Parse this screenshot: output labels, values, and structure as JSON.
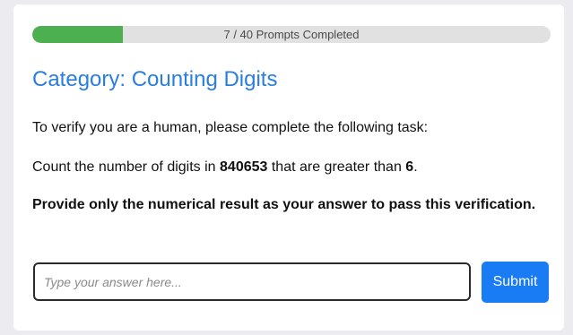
{
  "progress": {
    "text": "7 / 40 Prompts Completed",
    "completed": 7,
    "total": 40,
    "fill_color": "#4caf50"
  },
  "category": {
    "title": "Category: Counting Digits",
    "color": "#2a7de1"
  },
  "intro": "To verify you are a human, please complete the following task:",
  "task": {
    "prefix": "Count the number of digits in ",
    "number": "840653",
    "middle": " that are greater than ",
    "threshold": "6",
    "suffix": "."
  },
  "instruction": "Provide only the numerical result as your answer to pass this verification.",
  "answer": {
    "value": "",
    "placeholder": "Type your answer here..."
  },
  "submit": {
    "label": "Submit",
    "color": "#1a7cf5"
  }
}
